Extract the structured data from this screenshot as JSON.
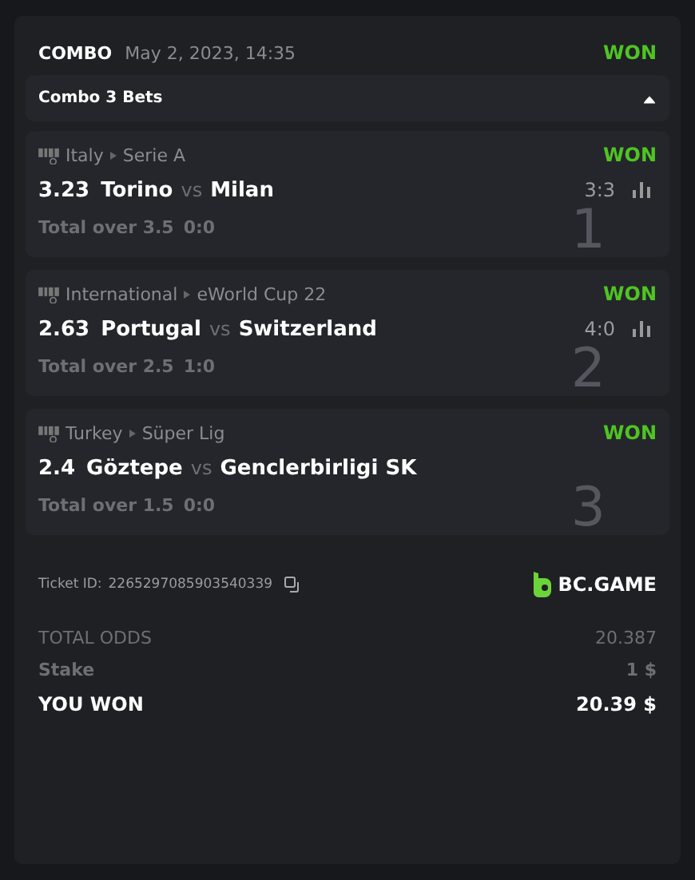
{
  "header": {
    "type": "COMBO",
    "date": "May 2, 2023, 14:35",
    "status": "WON"
  },
  "combo": {
    "label": "Combo 3 Bets",
    "expanded": true
  },
  "bets": [
    {
      "country": "Italy",
      "league": "Serie A",
      "status": "WON",
      "odds": "3.23",
      "home": "Torino",
      "vs": "vs",
      "away": "Milan",
      "score": "3:3",
      "stats": true,
      "market": "Total over 3.5",
      "market_score": "0:0",
      "number": "1"
    },
    {
      "country": "International",
      "league": "eWorld Cup 22",
      "status": "WON",
      "odds": "2.63",
      "home": "Portugal",
      "vs": "vs",
      "away": "Switzerland",
      "score": "4:0",
      "stats": true,
      "market": "Total over 2.5",
      "market_score": "1:0",
      "number": "2"
    },
    {
      "country": "Turkey",
      "league": "Süper Lig",
      "status": "WON",
      "odds": "2.4",
      "home": "Göztepe",
      "vs": "vs",
      "away": "Genclerbirligi SK",
      "stats": false,
      "market": "Total over 1.5",
      "market_score": "0:0",
      "number": "3"
    }
  ],
  "ticket": {
    "label": "Ticket ID:",
    "id": "2265297085903540339"
  },
  "brand": "BC.GAME",
  "summary": [
    {
      "kind": "muted",
      "label": "TOTAL ODDS",
      "value": "20.387"
    },
    {
      "kind": "stake",
      "label": "Stake",
      "value": "1 $"
    },
    {
      "kind": "total",
      "label": "YOU WON",
      "value": "20.39 $"
    }
  ]
}
